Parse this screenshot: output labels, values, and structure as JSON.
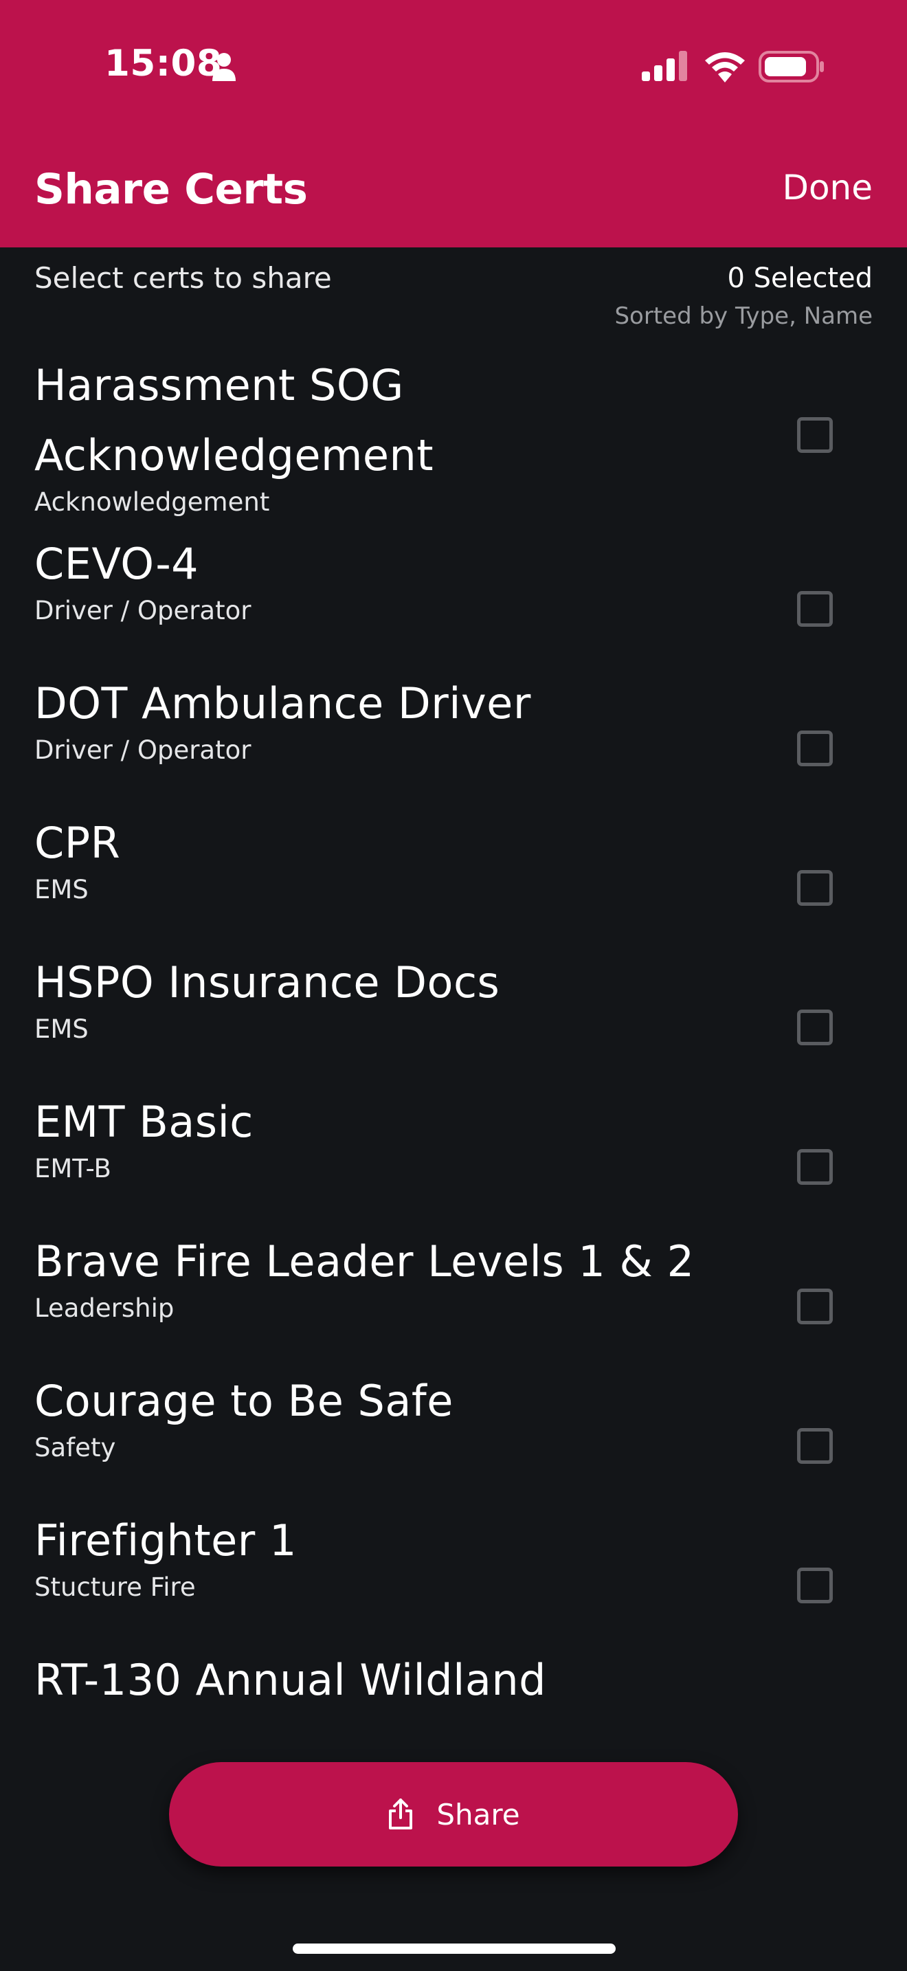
{
  "status_bar": {
    "time": "15:08"
  },
  "header": {
    "title": "Share Certs",
    "done_label": "Done",
    "background": "#bc124c"
  },
  "sub_header": {
    "hint": "Select certs to share",
    "selected": "0 Selected",
    "sort": "Sorted by Type, Name"
  },
  "certs": [
    {
      "name": "Harassment SOG Acknowledgement",
      "type": "Acknowledgement",
      "checked": false
    },
    {
      "name": "CEVO-4",
      "type": "Driver / Operator",
      "checked": false
    },
    {
      "name": "DOT Ambulance Driver",
      "type": "Driver / Operator",
      "checked": false
    },
    {
      "name": "CPR",
      "type": "EMS",
      "checked": false
    },
    {
      "name": "HSPO Insurance Docs",
      "type": "EMS",
      "checked": false
    },
    {
      "name": "EMT Basic",
      "type": "EMT-B",
      "checked": false
    },
    {
      "name": "Brave Fire Leader Levels 1 & 2",
      "type": "Leadership",
      "checked": false
    },
    {
      "name": "Courage to Be Safe",
      "type": "Safety",
      "checked": false
    },
    {
      "name": "Firefighter 1",
      "type": "Stucture Fire",
      "checked": false
    },
    {
      "name": "RT-130 Annual Wildland",
      "type": "",
      "checked": false
    }
  ],
  "share_button": {
    "label": "Share",
    "icon": "share-icon"
  }
}
